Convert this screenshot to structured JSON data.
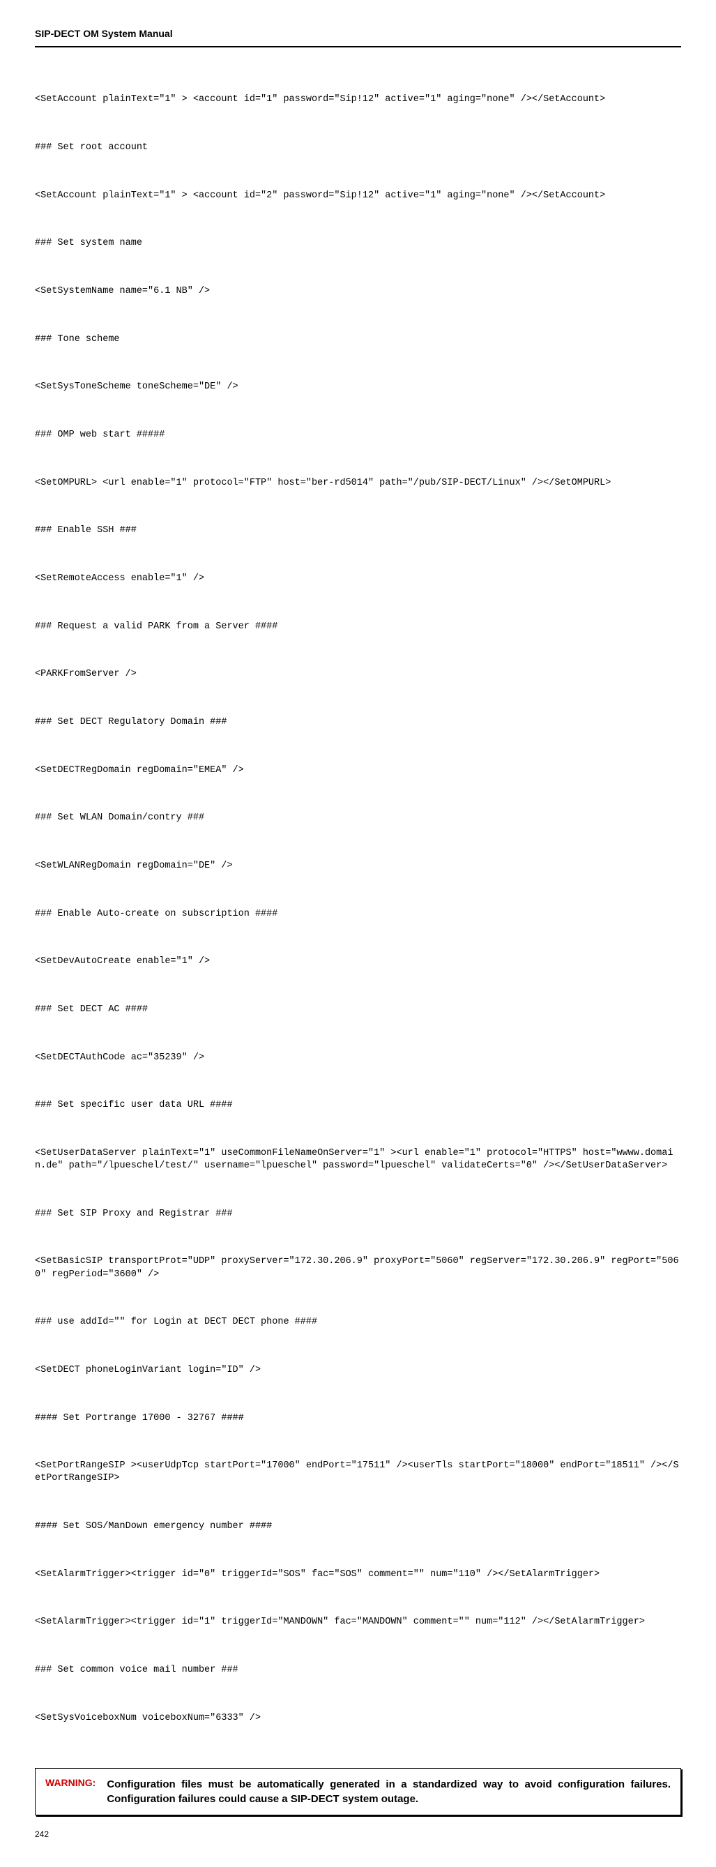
{
  "header": {
    "title": "SIP-DECT OM System Manual"
  },
  "code": {
    "lines": [
      "<SetAccount plainText=\"1\" > <account id=\"1\" password=\"Sip!12\" active=\"1\" aging=\"none\" /></SetAccount>",
      "### Set root account",
      "<SetAccount plainText=\"1\" > <account id=\"2\" password=\"Sip!12\" active=\"1\" aging=\"none\" /></SetAccount>",
      "### Set system name",
      "<SetSystemName name=\"6.1 NB\" />",
      "### Tone scheme",
      "<SetSysToneScheme toneScheme=\"DE\" />",
      "### OMP web start #####",
      "<SetOMPURL> <url enable=\"1\" protocol=\"FTP\" host=\"ber-rd5014\" path=\"/pub/SIP-DECT/Linux\" /></SetOMPURL>",
      "### Enable SSH ###",
      "<SetRemoteAccess enable=\"1\" />",
      "### Request a valid PARK from a Server ####",
      "<PARKFromServer />",
      "### Set DECT Regulatory Domain ###",
      "<SetDECTRegDomain regDomain=\"EMEA\" />",
      "### Set WLAN Domain/contry ###",
      "<SetWLANRegDomain regDomain=\"DE\" />",
      "### Enable Auto-create on subscription ####",
      "<SetDevAutoCreate enable=\"1\" />",
      "### Set DECT AC ####",
      "<SetDECTAuthCode ac=\"35239\" />",
      "### Set specific user data URL ####",
      "<SetUserDataServer plainText=\"1\" useCommonFileNameOnServer=\"1\" ><url enable=\"1\" protocol=\"HTTPS\" host=\"wwww.domain.de\" path=\"/lpueschel/test/\" username=\"lpueschel\" password=\"lpueschel\" validateCerts=\"0\" /></SetUserDataServer>",
      "### Set SIP Proxy and Registrar ###",
      "<SetBasicSIP transportProt=\"UDP\" proxyServer=\"172.30.206.9\" proxyPort=\"5060\" regServer=\"172.30.206.9\" regPort=\"5060\" regPeriod=\"3600\" />",
      "### use addId=\"\" for Login at DECT DECT phone ####",
      "<SetDECT phoneLoginVariant login=\"ID\" />",
      "#### Set Portrange 17000 - 32767 ####",
      "<SetPortRangeSIP ><userUdpTcp startPort=\"17000\" endPort=\"17511\" /><userTls startPort=\"18000\" endPort=\"18511\" /></SetPortRangeSIP>",
      "#### Set SOS/ManDown emergency number ####",
      "<SetAlarmTrigger><trigger id=\"0\" triggerId=\"SOS\" fac=\"SOS\" comment=\"\" num=\"110\" /></SetAlarmTrigger>",
      "<SetAlarmTrigger><trigger id=\"1\" triggerId=\"MANDOWN\" fac=\"MANDOWN\" comment=\"\" num=\"112\" /></SetAlarmTrigger>",
      "### Set common voice mail number ###",
      "<SetSysVoiceboxNum voiceboxNum=\"6333\" />"
    ]
  },
  "warning": {
    "label": "WARNING:",
    "text": "Configuration files must be automatically generated in a standardized way to avoid configuration failures. Configuration failures could cause a SIP-DECT system outage."
  },
  "footer": {
    "pageNumber": "242"
  }
}
